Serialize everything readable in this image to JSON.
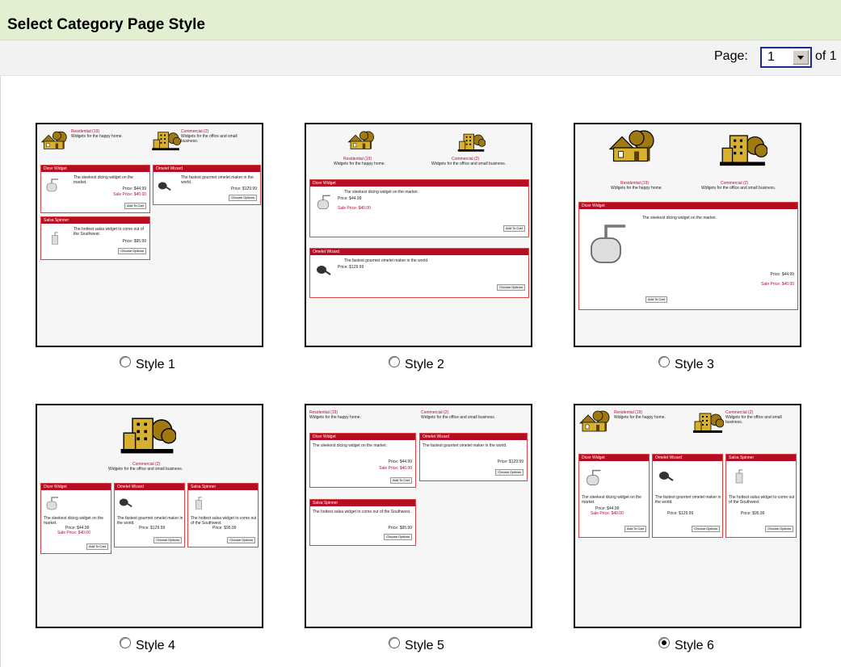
{
  "header": {
    "title": "Select Category Page Style"
  },
  "pager": {
    "label": "Page:",
    "value": "1",
    "of": "of 1"
  },
  "styles": [
    {
      "label": "Style 1",
      "selected": false
    },
    {
      "label": "Style 2",
      "selected": false
    },
    {
      "label": "Style 3",
      "selected": false
    },
    {
      "label": "Style 4",
      "selected": false
    },
    {
      "label": "Style 5",
      "selected": false
    },
    {
      "label": "Style 6",
      "selected": true
    }
  ],
  "preview": {
    "residential": "Residential (19)",
    "residential_desc": "Widgets for the happy home.",
    "commercial": "Commercial (2)",
    "commercial_desc": "Widgets for the office and small business.",
    "dicer": "Dicer Widget",
    "dicer_desc": "The sleekest dicing widget on the market.",
    "dicer_price": "Price: $44.99",
    "dicer_sale": "Sale Price: $40.00",
    "omelet": "Omelet Wizard",
    "omelet_desc": "The fastest gourmet omelet maker in the world.",
    "omelet_price": "Price: $129.99",
    "salsa": "Salsa Spinner",
    "salsa_desc": "The hottest salsa widget to come out of the Southwest.",
    "salsa_price": "Price: $95.99",
    "add_to_cart": "Add To Cart",
    "choose_options": "Choose Options"
  }
}
